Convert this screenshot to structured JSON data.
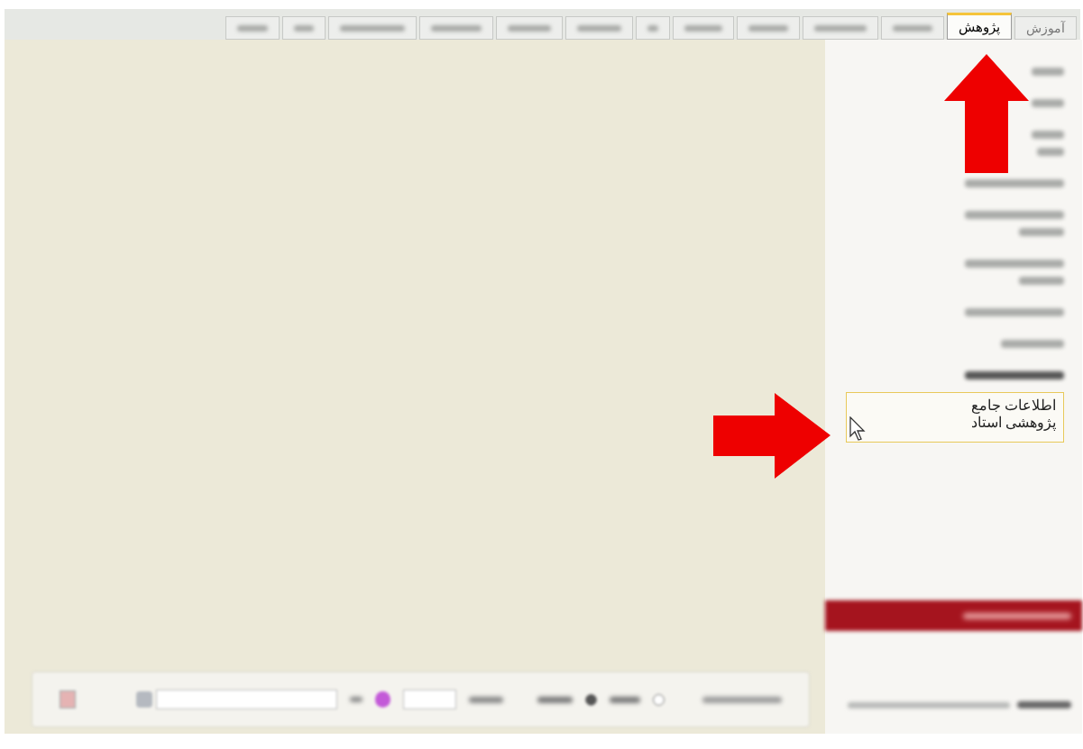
{
  "tabs": [
    {
      "label": "آموزش",
      "selected": false
    },
    {
      "label": "پژوهش",
      "selected": true
    },
    {
      "kind": "blurred",
      "selected": false
    },
    {
      "kind": "blurred",
      "selected": false
    },
    {
      "kind": "blurred",
      "selected": false
    },
    {
      "kind": "blurred",
      "selected": false
    },
    {
      "kind": "blurred",
      "selected": false
    },
    {
      "kind": "blurred",
      "selected": false
    },
    {
      "kind": "blurred",
      "selected": false
    },
    {
      "kind": "blurred",
      "selected": false
    },
    {
      "kind": "blurred",
      "selected": false
    },
    {
      "kind": "blurred",
      "selected": false
    },
    {
      "kind": "blurred",
      "selected": false
    }
  ],
  "sidebar": {
    "items": [
      {
        "kind": "blurred_narrow"
      },
      {
        "kind": "blurred_narrow"
      },
      {
        "kind": "blurred_narrow_two_lines"
      },
      {
        "kind": "blurred_long"
      },
      {
        "kind": "blurred_two_lines"
      },
      {
        "kind": "blurred_two_lines"
      },
      {
        "kind": "blurred_long"
      },
      {
        "kind": "blurred_short"
      },
      {
        "kind": "blurred_bold"
      },
      {
        "kind": "text",
        "label": "اطلاعات جامع پژوهشی استاد",
        "hovered": true
      }
    ],
    "red_button": {
      "kind": "blurred"
    },
    "footer": {
      "kind": "blurred"
    }
  },
  "annotations": [
    {
      "kind": "arrow_up"
    },
    {
      "kind": "arrow_right"
    }
  ],
  "bottom_bar": {
    "kind": "blurred",
    "options": [
      {
        "selected": false
      },
      {
        "selected": true
      }
    ]
  }
}
